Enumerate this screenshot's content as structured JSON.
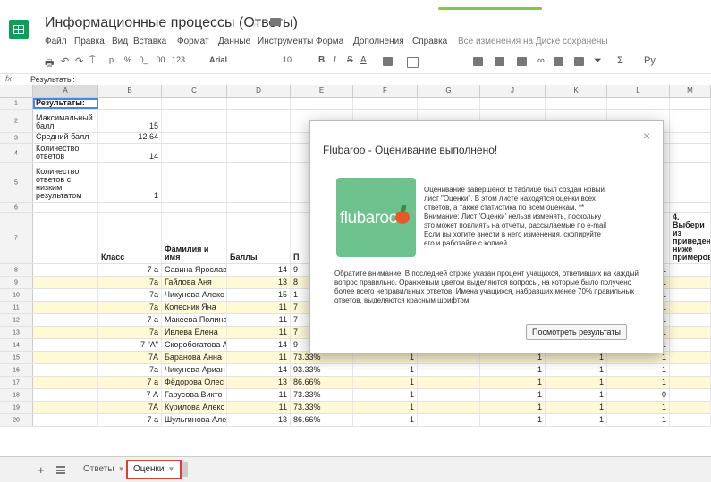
{
  "header": {
    "title": "Информационные процессы (Ответы)",
    "menu": [
      "Файл",
      "Правка",
      "Вид",
      "Вставка",
      "Формат",
      "Данные",
      "Инструменты",
      "Форма",
      "Дополнения",
      "Справка"
    ],
    "save_status": "Все изменения на Диске сохранены"
  },
  "toolbar": {
    "percent": "%",
    "dec_less": ".0_",
    "dec_more": ".00",
    "number_format": "123",
    "font": "Arial",
    "font_size": "10",
    "bold": "B",
    "italic": "I",
    "strike": "S",
    "text_color": "A",
    "sum": "Σ",
    "script": "Py"
  },
  "formula_bar": {
    "fx": "fx",
    "content": "Результаты:"
  },
  "columns": [
    "A",
    "B",
    "C",
    "D",
    "E",
    "F",
    "G",
    "H",
    "J",
    "K",
    "L",
    "M"
  ],
  "rows": [
    {
      "num": "1",
      "a": "Результаты:"
    },
    {
      "num": "2",
      "a": "Максимальный балл",
      "b": "15"
    },
    {
      "num": "3",
      "a": "Средний балл",
      "b": "12.64"
    },
    {
      "num": "4",
      "a": "Количество ответов",
      "b": "14"
    },
    {
      "num": "5",
      "a": "Количество ответов с низким результатом",
      "b": "1"
    },
    {
      "num": "6"
    },
    {
      "num": "7",
      "b": "Класс",
      "c": "Фамилия и имя",
      "d": "Баллы",
      "e": "П",
      "m": "4. Выбери из приведенных ниже примеров"
    },
    {
      "num": "8",
      "b": "7 а",
      "c": "Савина Ярослав",
      "d": "14",
      "e": "9",
      "l": "1"
    },
    {
      "num": "9",
      "b": "7а",
      "c": "Гайлова Аня",
      "d": "13",
      "e": "8",
      "l": "1"
    },
    {
      "num": "10",
      "b": "7а",
      "c": "Чикунова Алекс",
      "d": "15",
      "e": "1",
      "l": "1"
    },
    {
      "num": "11",
      "b": "7а",
      "c": "Колесник Яна",
      "d": "11",
      "e": "7",
      "l": "1"
    },
    {
      "num": "12",
      "b": "7 а",
      "c": "Макеева Полина",
      "d": "11",
      "e": "7",
      "l": "1"
    },
    {
      "num": "13",
      "b": "7а",
      "c": "Ивлева Елена",
      "d": "11",
      "e": "7",
      "l": "1"
    },
    {
      "num": "14",
      "b": "7 \"А\"",
      "c": "Скоробогатова А",
      "d": "14",
      "e": "9",
      "l": "1"
    },
    {
      "num": "15",
      "b": "7А",
      "c": "Баранова Анна",
      "d": "11",
      "e": "73.33%",
      "f": "1",
      "j": "1",
      "k": "1",
      "l": "1"
    },
    {
      "num": "16",
      "b": "7а",
      "c": "Чикунова Ариан",
      "d": "14",
      "e": "93.33%",
      "f": "1",
      "j": "1",
      "k": "1",
      "l": "1"
    },
    {
      "num": "17",
      "b": "7 а",
      "c": "Фёдорова Олес",
      "d": "13",
      "e": "86.66%",
      "f": "1",
      "j": "1",
      "k": "1",
      "l": "1"
    },
    {
      "num": "18",
      "b": "7 А",
      "c": "Гарусова Викто",
      "d": "11",
      "e": "73.33%",
      "f": "1",
      "j": "1",
      "k": "1",
      "l": "0"
    },
    {
      "num": "19",
      "b": "7А",
      "c": "Курилова Алекс",
      "d": "11",
      "e": "73.33%",
      "f": "1",
      "j": "1",
      "k": "1",
      "l": "1"
    },
    {
      "num": "20",
      "b": "7 а",
      "c": "Шульгинова Але",
      "d": "13",
      "e": "86.66%",
      "f": "1",
      "j": "1",
      "k": "1",
      "l": "1"
    }
  ],
  "sheets": [
    {
      "label": "Ответы",
      "active": false
    },
    {
      "label": "Оценки",
      "active": true
    }
  ],
  "modal": {
    "title": "Flubaroo - Оценивание выполнено!",
    "logo_text": "flubaroo",
    "paragraph1": "Оценивание завершено! В таблице был создан новый лист \"Оценки\". В этом листе находятся оценки всех ответов, а также статистика по всем оценкам. ** Внимание: Лист 'Оценки' нельзя изменять, поскольку это может повлиять на отчеты, рассылаемые по e-mail Если вы хотите внести в него изменения, скопируйте его и работайте с копией",
    "paragraph2": "Обратите внимание: В последней строке указан процент учащихся, ответивших на каждый вопрос правильно. Оранжевым цветом выделяются вопросы, на которые было получено более всего неправильных ответов. Имена учащихся, набравших менее 70% правильных ответов, выделяются красным шрифтом.",
    "button": "Посмотреть результаты",
    "close": "×"
  },
  "colors": {
    "accent": "#0f9d58",
    "alt_row": "#fff9d6",
    "active_tab_border": "#e03b3b",
    "selection": "#4a86e8"
  }
}
